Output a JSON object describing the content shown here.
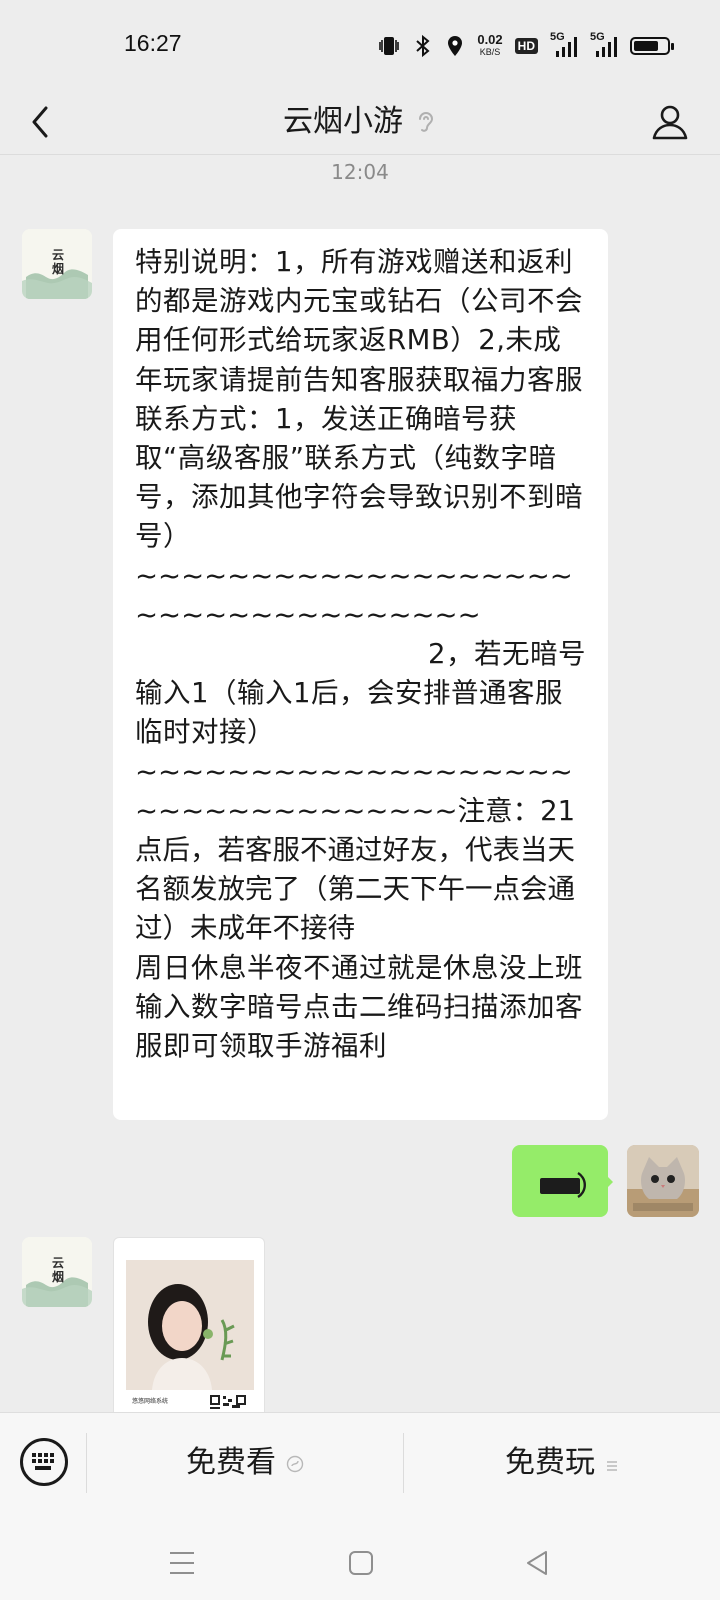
{
  "status_bar": {
    "time": "16:27",
    "speed_value": "0.02",
    "speed_unit": "KB/S",
    "hd_label": "HD",
    "net1": "5G",
    "net2": "5G",
    "battery_level": 0.75
  },
  "header": {
    "title": "云烟小游",
    "back_icon": "chevron-left-icon",
    "mute_icon": "ear-icon",
    "profile_icon": "person-icon"
  },
  "chat": {
    "timestamp": "12:04",
    "message": {
      "p1": "特别说明：1，所有游戏赠送和返利的都是游戏内元宝或钻石（公司不会用任何形式给玩家返RMB）2,未成年玩家请提前告知客服获取福力客服联系方式：1，发送正确暗号获取“高级客服”联系方式（纯数字暗号，添加其他字符会导致识别不到暗号）",
      "tilde1": "~~~~~~~~~~~~~~~~~~~~~~~~~~~~~~~~~~",
      "right_line": "2，若无暗号",
      "p2": "输入1（输入1后，会安排普通客服临时对接）",
      "p3": "~~~~~~~~~~~~~~~~~~~~~~~~~~~~~~~~~注意：21点后，若客服不通过好友，代表当天名额发放完了（第二天下午一点会通过）未成年不接待",
      "p4": "周日休息半夜不通过就是休息没上班 输入数字暗号点击二维码扫描添加客服即可领取手游福利"
    },
    "avatar_text": "云烟",
    "card_caption": "悠悠网络系统"
  },
  "bottom_menu": {
    "item1": "免费看",
    "item2": "免费玩"
  }
}
